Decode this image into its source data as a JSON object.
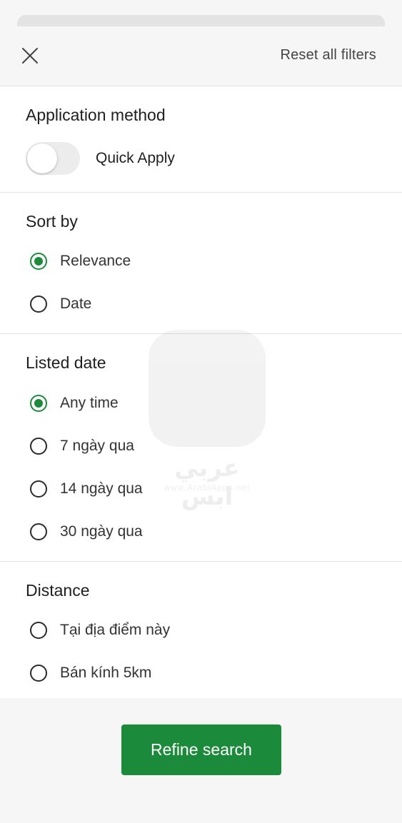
{
  "header": {
    "close_icon": "close-icon",
    "reset_label": "Reset all filters"
  },
  "application_method": {
    "title": "Application method",
    "toggle_label": "Quick Apply",
    "toggle_on": false
  },
  "sort_by": {
    "title": "Sort by",
    "options": [
      {
        "label": "Relevance",
        "selected": true
      },
      {
        "label": "Date",
        "selected": false
      }
    ]
  },
  "listed_date": {
    "title": "Listed date",
    "options": [
      {
        "label": "Any time",
        "selected": true
      },
      {
        "label": "7 ngày qua",
        "selected": false
      },
      {
        "label": "14 ngày qua",
        "selected": false
      },
      {
        "label": "30 ngày qua",
        "selected": false
      }
    ]
  },
  "distance": {
    "title": "Distance",
    "options": [
      {
        "label": "Tại địa điểm này",
        "selected": false
      },
      {
        "label": "Bán kính 5km",
        "selected": false
      }
    ]
  },
  "watermark": {
    "arabic_text": "عربي ابس",
    "url_text": "www.ArabiApps.net"
  },
  "footer": {
    "refine_label": "Refine search"
  },
  "colors": {
    "accent": "#1b8a3a",
    "background": "#f6f6f6",
    "panel": "#ffffff"
  }
}
